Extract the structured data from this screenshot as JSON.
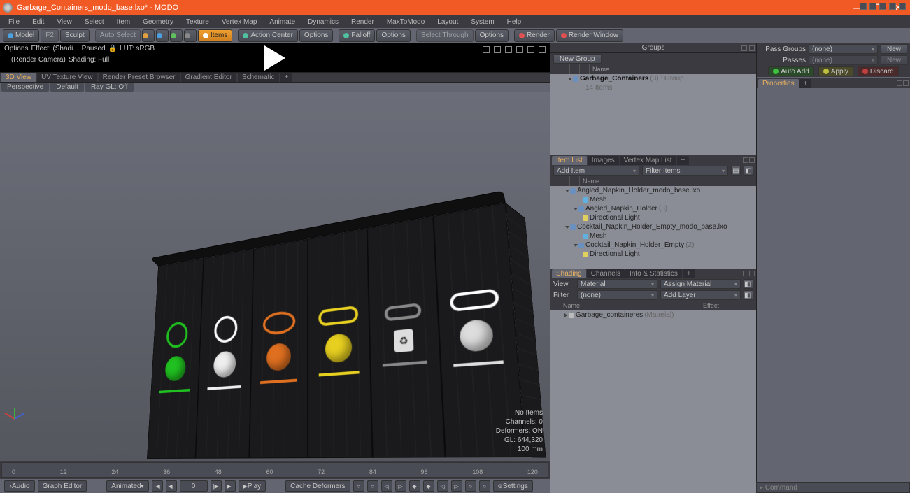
{
  "title": "Garbage_Containers_modo_base.lxo* - MODO",
  "menu": [
    "File",
    "Edit",
    "View",
    "Select",
    "Item",
    "Geometry",
    "Texture",
    "Vertex Map",
    "Animate",
    "Dynamics",
    "Render",
    "MaxToModo",
    "Layout",
    "System",
    "Help"
  ],
  "toolbar": {
    "model": "Model",
    "f2": "F2",
    "sculpt": "Sculpt",
    "autoselect": "Auto Select",
    "items": "Items",
    "actioncenter": "Action Center",
    "options": "Options",
    "falloff": "Falloff",
    "options2": "Options",
    "selthrough": "Select Through",
    "options3": "Options",
    "render": "Render",
    "renderwin": "Render Window"
  },
  "renderbar": {
    "options": "Options",
    "effect": "Effect: (Shadi...",
    "paused": "Paused",
    "lut": "LUT: sRGB",
    "camera": "(Render Camera)",
    "shading": "Shading: Full"
  },
  "viewtabs": [
    "3D View",
    "UV Texture View",
    "Render Preset Browser",
    "Gradient Editor",
    "Schematic"
  ],
  "viewopts": {
    "persp": "Perspective",
    "default": "Default",
    "raygl": "Ray GL: Off"
  },
  "overlay": {
    "l1": "No Items",
    "l2": "Channels: 0",
    "l3": "Deformers: ON",
    "l4": "GL: 644,320",
    "l5": "100 mm"
  },
  "timeline": [
    "0",
    "12",
    "24",
    "36",
    "48",
    "60",
    "72",
    "84",
    "96",
    "108",
    "120"
  ],
  "playbar": {
    "audio": "Audio",
    "graph": "Graph Editor",
    "animated": "Animated",
    "frame": "0",
    "play": "Play",
    "cache": "Cache Deformers",
    "settings": "Settings"
  },
  "groups": {
    "title": "Groups",
    "new": "New Group",
    "hdr": "Name",
    "item": "Garbage_Containers",
    "meta": "(3) : Group",
    "sub": "14 Items"
  },
  "passes": {
    "passg": "Pass Groups",
    "passes": "Passes",
    "none": "(none)",
    "new": "New",
    "autoadd": "Auto Add",
    "apply": "Apply",
    "discard": "Discard"
  },
  "props": {
    "title": "Properties"
  },
  "itemlist": {
    "tabs": [
      "Item List",
      "Images",
      "Vertex Map List"
    ],
    "add": "Add Item",
    "filter": "Filter Items",
    "hdr": "Name",
    "rows": [
      {
        "ind": 16,
        "tri": true,
        "txt": "Angled_Napkin_Holder_modo_base.lxo"
      },
      {
        "ind": 40,
        "mesh": true,
        "txt": "Mesh"
      },
      {
        "ind": 28,
        "tri": true,
        "txt": "Angled_Napkin_Holder",
        "dim": "(3)"
      },
      {
        "ind": 40,
        "light": true,
        "txt": "Directional Light"
      },
      {
        "ind": 16,
        "tri": true,
        "txt": "Cocktail_Napkin_Holder_Empty_modo_base.lxo"
      },
      {
        "ind": 40,
        "mesh": true,
        "txt": "Mesh"
      },
      {
        "ind": 28,
        "tri": true,
        "txt": "Cocktail_Napkin_Holder_Empty",
        "dim": "(2)"
      },
      {
        "ind": 40,
        "light": true,
        "txt": "Directional Light"
      }
    ]
  },
  "shading": {
    "tabs": [
      "Shading",
      "Channels",
      "Info & Statistics"
    ],
    "view": "View",
    "material": "Material",
    "assign": "Assign Material",
    "filterl": "Filter",
    "none": "(none)",
    "addlayer": "Add Layer",
    "hname": "Name",
    "heffect": "Effect",
    "item": "Garbage_containeres",
    "meta": "(Material)"
  },
  "cmd": "Command"
}
